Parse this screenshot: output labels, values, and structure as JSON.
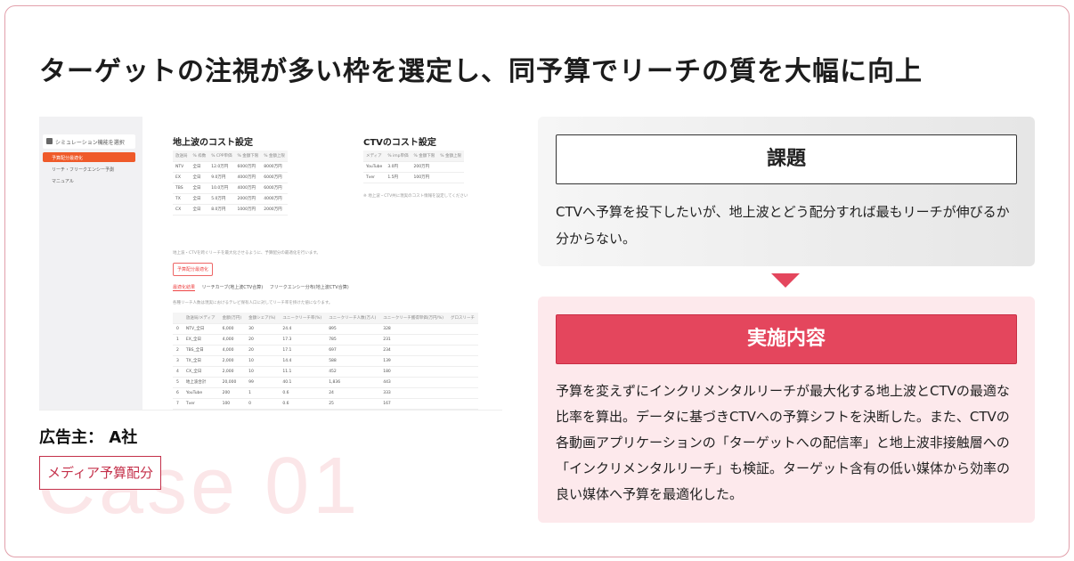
{
  "headline": "ターゲットの注視が多い枠を選定し、同予算でリーチの質を大幅に向上",
  "watermark": "Case 01",
  "screenshot": {
    "sidebar_title": "シミュレーション機能を選択",
    "sidebar_items": [
      "予算配分最適化",
      "リーチ・フリークエンシー予測",
      "マニュアル"
    ],
    "terrestrial_title": "地上波のコスト設定",
    "terrestrial_headers": [
      "放送局",
      "% 枠数",
      "% CPP単価",
      "% 金額下限",
      "% 金額上限"
    ],
    "terrestrial_rows": [
      [
        "NTV",
        "全日",
        "12.0万円",
        "6000万円",
        "8000万円"
      ],
      [
        "EX",
        "全日",
        "9.0万円",
        "4000万円",
        "6000万円"
      ],
      [
        "TBS",
        "全日",
        "10.0万円",
        "4000万円",
        "6000万円"
      ],
      [
        "TX",
        "全日",
        "5.0万円",
        "2000万円",
        "4000万円"
      ],
      [
        "CX",
        "全日",
        "8.0万円",
        "1000万円",
        "2000万円"
      ]
    ],
    "ctv_title": "CTVのコスト設定",
    "ctv_headers": [
      "メディア",
      "% imp単価",
      "% 金額下限",
      "% 金額上限"
    ],
    "ctv_rows": [
      [
        "YouTube",
        "3.0円",
        "200万円",
        ""
      ],
      [
        "Tver",
        "1.5円",
        "100万円",
        ""
      ]
    ],
    "ctv_note": "※ 地上波・CTV共に現実のコスト情報を設定してください",
    "desc_text": "地上波・CTVを跨ぐリーチを最大化させるように、予算配分の最適化を行います。",
    "optimize_button": "予算配分最適化",
    "tabs": [
      "最適化結果",
      "リーチカーブ(地上波CTV合算)",
      "フリークエンシー分布(地上波CTV合算)"
    ],
    "result_note": "各種リーチ人数は現実におけるテレビ保有人口に対してリーチ率を掛けた値になります。",
    "result_headers": [
      "",
      "放送局/メディア",
      "金額(万円)",
      "金額シェア(%)",
      "ユニークリーチ率(%)",
      "ユニークリーチ人数(万人)",
      "ユニークリーチ獲得単価(万円/%)",
      "グロスリーチ"
    ],
    "result_rows": [
      [
        "0",
        "NTV_全日",
        "6,000",
        "30",
        "24.4",
        "895",
        "328",
        ""
      ],
      [
        "1",
        "EX_全日",
        "4,000",
        "20",
        "17.3",
        "785",
        "231",
        ""
      ],
      [
        "2",
        "TBS_全日",
        "4,000",
        "20",
        "17.1",
        "697",
        "234",
        ""
      ],
      [
        "3",
        "TX_全日",
        "2,000",
        "10",
        "14.4",
        "588",
        "139",
        ""
      ],
      [
        "4",
        "CX_全日",
        "2,000",
        "10",
        "11.1",
        "452",
        "180",
        ""
      ],
      [
        "5",
        "地上波合計",
        "20,000",
        "99",
        "40.1",
        "1,836",
        "443",
        ""
      ],
      [
        "6",
        "YouTube",
        "200",
        "1",
        "0.6",
        "24",
        "333",
        ""
      ],
      [
        "7",
        "Tver",
        "100",
        "0",
        "0.6",
        "25",
        "167",
        ""
      ]
    ]
  },
  "advertiser": "広告主： A社",
  "tag": "メディア予算配分",
  "issue": {
    "label": "課題",
    "text": "CTVへ予算を投下したいが、地上波とどう配分すれば最もリーチが伸びるか分からない。"
  },
  "action": {
    "label": "実施内容",
    "text": "予算を変えずにインクリメンタルリーチが最大化する地上波とCTVの最適な比率を算出。データに基づきCTVへの予算シフトを決断した。また、CTVの各動画アプリケーションの「ターゲットへの配信率」と地上波非接触層への「インクリメンタルリーチ」も検証。ターゲット含有の低い媒体から効率の良い媒体へ予算を最適化した。"
  },
  "colors": {
    "accent": "#e4465d",
    "border": "#c4304a",
    "panel_pink": "#fde9ec"
  }
}
